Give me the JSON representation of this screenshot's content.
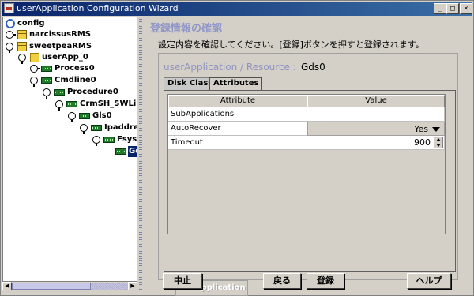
{
  "window": {
    "title": "userApplication Configuration Wizard",
    "controls": {
      "minimize": "_",
      "maximize": "□",
      "close": "×"
    }
  },
  "tree": {
    "items": [
      {
        "label": "config",
        "icon": "config-icon",
        "handle": "none"
      },
      {
        "label": "narcissusRMS",
        "icon": "grid-icon",
        "handle": "collapsed"
      },
      {
        "label": "sweetpeaRMS",
        "icon": "grid-icon",
        "handle": "expanded"
      },
      {
        "label": "userApp_0",
        "icon": "warning-icon",
        "handle": "expanded"
      },
      {
        "label": "Process0",
        "icon": "resource-icon",
        "handle": "collapsed"
      },
      {
        "label": "Cmdline0",
        "icon": "resource-icon",
        "handle": "expanded"
      },
      {
        "label": "Procedure0",
        "icon": "resource-icon",
        "handle": "expanded"
      },
      {
        "label": "CrmSH_SWLine",
        "icon": "resource-icon",
        "handle": "expanded"
      },
      {
        "label": "Gls0",
        "icon": "resource-icon",
        "handle": "expanded"
      },
      {
        "label": "Ipaddress",
        "icon": "resource-icon",
        "handle": "expanded"
      },
      {
        "label": "Fsyste",
        "icon": "resource-icon",
        "handle": "expanded"
      },
      {
        "label": "Gd",
        "icon": "resource-icon",
        "handle": "none",
        "selected": true
      }
    ]
  },
  "main": {
    "section_title": "登録情報の確認",
    "instruction": "設定内容を確認してください。[登録]ボタンを押すと登録されます。",
    "resource_path": "userApplication / Resource  :",
    "resource_name": "Gds0",
    "tabs": [
      {
        "label": "Disk Class",
        "active": false
      },
      {
        "label": "Attributes",
        "active": true
      }
    ],
    "table": {
      "columns": [
        "Attribute",
        "Value"
      ],
      "rows": [
        {
          "attribute": "SubApplications",
          "value": "",
          "kind": "text"
        },
        {
          "attribute": "AutoRecover",
          "value": "Yes",
          "kind": "select"
        },
        {
          "attribute": "Timeout",
          "value": "900",
          "kind": "spinner"
        }
      ]
    },
    "subapplication_button": "SubApplication"
  },
  "footer": {
    "abort": "中止",
    "back": "戻る",
    "register": "登録",
    "help": "ヘルプ"
  }
}
